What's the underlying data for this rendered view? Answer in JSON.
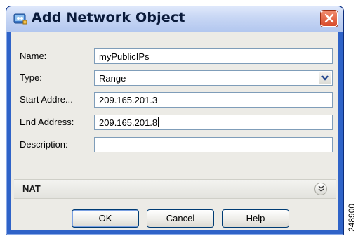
{
  "window": {
    "title": "Add Network Object"
  },
  "form": {
    "name_label": "Name:",
    "name_value": "myPublicIPs",
    "type_label": "Type:",
    "type_value": "Range",
    "start_label": "Start Addre...",
    "start_value": "209.165.201.3",
    "end_label": "End Address:",
    "end_value": "209.165.201.8",
    "description_label": "Description:",
    "description_value": ""
  },
  "nat": {
    "label": "NAT"
  },
  "buttons": {
    "ok": "OK",
    "cancel": "Cancel",
    "help": "Help"
  },
  "side_code": "248900",
  "icons": {
    "title": "network-object-icon",
    "close": "close-icon",
    "select": "chevron-down-icon",
    "expand": "double-chevron-down-icon"
  },
  "colors": {
    "title_bar": "#c7d6f4",
    "window_border": "#2f63c8",
    "close": "#d74a2a",
    "client": "#ecebe6"
  }
}
